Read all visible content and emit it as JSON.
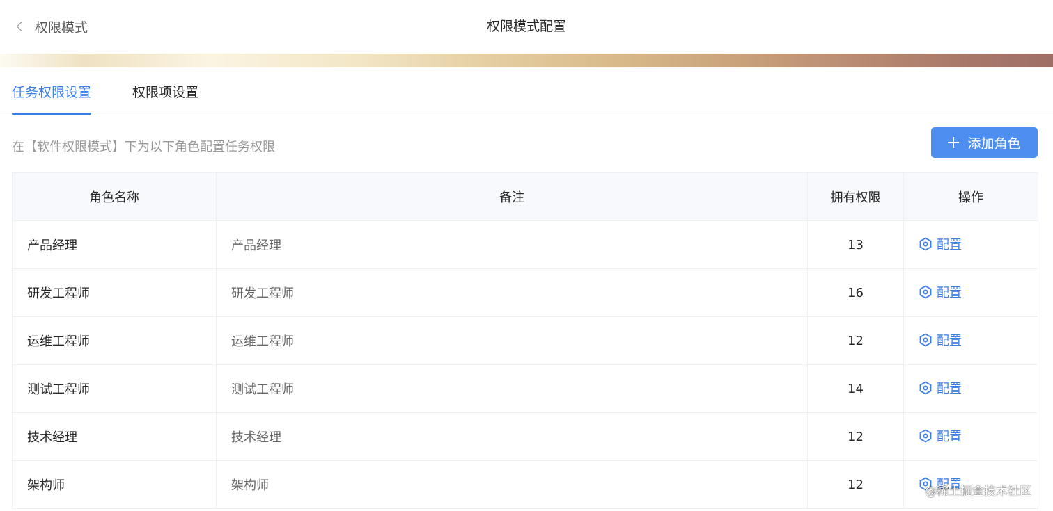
{
  "header": {
    "back_label": "权限模式",
    "title": "权限模式配置"
  },
  "tabs": [
    {
      "label": "任务权限设置",
      "active": true
    },
    {
      "label": "权限项设置",
      "active": false
    }
  ],
  "toolbar": {
    "hint": "在【软件权限模式】下为以下角色配置任务权限",
    "add_label": "添加角色"
  },
  "table": {
    "headers": [
      "角色名称",
      "备注",
      "拥有权限",
      "操作"
    ],
    "rows": [
      {
        "name": "产品经理",
        "note": "产品经理",
        "count": "13",
        "action": "配置"
      },
      {
        "name": "研发工程师",
        "note": "研发工程师",
        "count": "16",
        "action": "配置"
      },
      {
        "name": "运维工程师",
        "note": "运维工程师",
        "count": "12",
        "action": "配置"
      },
      {
        "name": "测试工程师",
        "note": "测试工程师",
        "count": "14",
        "action": "配置"
      },
      {
        "name": "技术经理",
        "note": "技术经理",
        "count": "12",
        "action": "配置"
      },
      {
        "name": "架构师",
        "note": "架构师",
        "count": "12",
        "action": "配置"
      }
    ]
  },
  "watermark": "@稀土掘金技术社区",
  "icons": {
    "back": "chevron-left-icon",
    "add": "plus-icon",
    "config": "hexagon-gear-icon"
  },
  "colors": {
    "primary": "#3a7ee6",
    "button": "#4d8ef0",
    "header_bg": "#f7f9fc"
  }
}
